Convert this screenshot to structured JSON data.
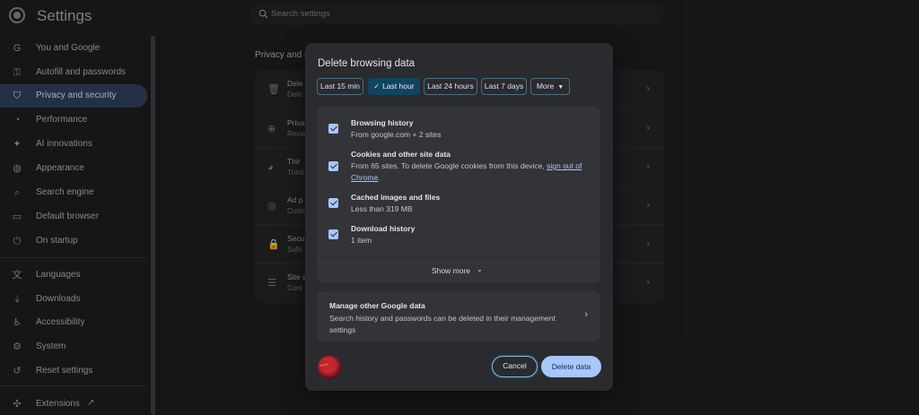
{
  "app": {
    "title": "Settings"
  },
  "search": {
    "placeholder": "Search settings"
  },
  "sidebar": {
    "items": [
      {
        "label": "You and Google",
        "icon": "google-g-icon",
        "active": false
      },
      {
        "label": "Autofill and passwords",
        "icon": "key-icon",
        "active": false
      },
      {
        "label": "Privacy and security",
        "icon": "shield-icon",
        "active": true
      },
      {
        "label": "Performance",
        "icon": "speedometer-icon",
        "active": false
      },
      {
        "label": "AI innovations",
        "icon": "sparkle-icon",
        "active": false
      },
      {
        "label": "Appearance",
        "icon": "palette-icon",
        "active": false
      },
      {
        "label": "Search engine",
        "icon": "search-icon",
        "active": false
      },
      {
        "label": "Default browser",
        "icon": "browser-icon",
        "active": false
      },
      {
        "label": "On startup",
        "icon": "power-icon",
        "active": false
      },
      {
        "label": "Languages",
        "icon": "translate-icon",
        "active": false
      },
      {
        "label": "Downloads",
        "icon": "download-icon",
        "active": false
      },
      {
        "label": "Accessibility",
        "icon": "accessibility-icon",
        "active": false
      },
      {
        "label": "System",
        "icon": "wrench-icon",
        "active": false
      },
      {
        "label": "Reset settings",
        "icon": "reset-icon",
        "active": false
      },
      {
        "label": "Extensions",
        "icon": "puzzle-icon",
        "active": false
      }
    ]
  },
  "main": {
    "section_heading": "Privacy and s",
    "rows": [
      {
        "title": "Dele",
        "sub": "Dele",
        "icon": "trash-icon"
      },
      {
        "title": "Priva",
        "sub": "Revie",
        "icon": "privacy-guide-icon"
      },
      {
        "title": "Thir",
        "sub": "Third",
        "icon": "cookie-icon"
      },
      {
        "title": "Ad p",
        "sub": "Custo",
        "icon": "ad-privacy-icon"
      },
      {
        "title": "Secu",
        "sub": "Safe",
        "icon": "lock-icon"
      },
      {
        "title": "Site s",
        "sub": "Cont",
        "icon": "sliders-icon"
      }
    ]
  },
  "dialog": {
    "title": "Delete browsing data",
    "time_ranges": [
      {
        "label": "Last 15 min",
        "selected": false
      },
      {
        "label": "Last hour",
        "selected": true
      },
      {
        "label": "Last 24 hours",
        "selected": false
      },
      {
        "label": "Last 7 days",
        "selected": false
      },
      {
        "label": "More",
        "selected": false
      }
    ],
    "options": [
      {
        "title": "Browsing history",
        "sub": "From google.com + 2 sites",
        "checked": true
      },
      {
        "title": "Cookies and other site data",
        "sub": "From 65 sites. To delete Google cookies from this device, ",
        "link": "sign out of Chrome",
        "sub_end": ".",
        "checked": true
      },
      {
        "title": "Cached images and files",
        "sub": "Less than 319 MB",
        "checked": true
      },
      {
        "title": "Download history",
        "sub": "1 item",
        "checked": true
      }
    ],
    "show_more": "Show more",
    "manage": {
      "title": "Manage other Google data",
      "sub": "Search history and passwords can be deleted in their management settings"
    },
    "cancel_label": "Cancel",
    "delete_label": "Delete data",
    "accent": "#a8c7fa"
  }
}
